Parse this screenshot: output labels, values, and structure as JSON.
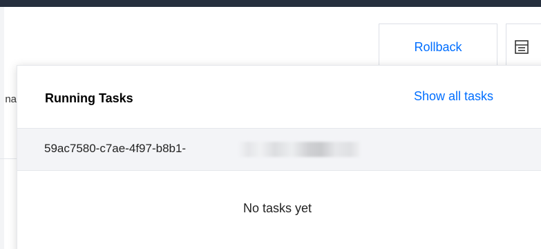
{
  "toolbar": {
    "rollback_label": "Rollback",
    "panel_icon": "panel-list-icon"
  },
  "background": {
    "cut_text": "na"
  },
  "tasks_popover": {
    "title": "Running Tasks",
    "show_all_label": "Show all tasks",
    "task_id": "59ac7580-c7ae-4f97-b8b1-",
    "empty_message": "No tasks yet"
  },
  "colors": {
    "accent": "#006eff",
    "top_bar": "#262f3e",
    "row_background": "#f3f4f7"
  }
}
